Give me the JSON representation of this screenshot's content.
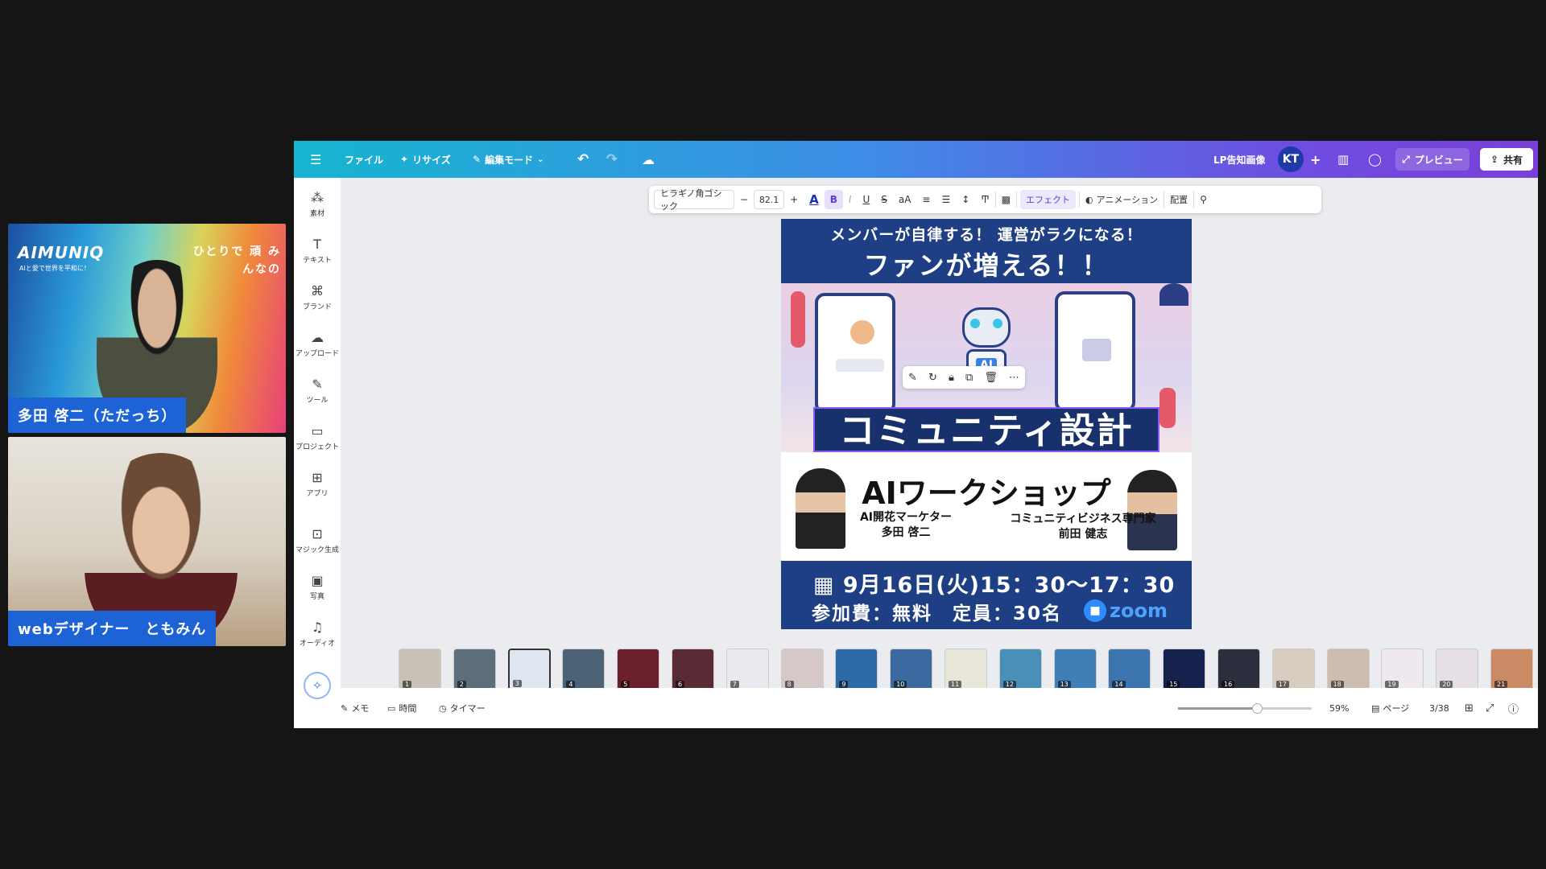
{
  "participants": [
    {
      "name": "多田 啓二（ただっち）",
      "bg_logo": "AIMUNIQ",
      "bg_logo_sub": "AIと愛で世界を平和に！",
      "bg_tagline": "ひとりで 頑 みんなの"
    },
    {
      "name": "webデザイナー　ともみん"
    }
  ],
  "topbar": {
    "menu_icon": "hamburger-icon",
    "file": "ファイル",
    "resize": "リサイズ",
    "edit_mode": "編集モード",
    "project_name": "LP告知画像",
    "avatar": "KT",
    "add": "+",
    "preview": "プレビュー",
    "share": "共有"
  },
  "sidebar": [
    {
      "label": "素材",
      "icon": "elements-icon"
    },
    {
      "label": "テキスト",
      "icon": "text-icon"
    },
    {
      "label": "ブランド",
      "icon": "brand-icon"
    },
    {
      "label": "アップロード",
      "icon": "upload-icon"
    },
    {
      "label": "ツール",
      "icon": "draw-icon"
    },
    {
      "label": "プロジェクト",
      "icon": "folder-icon"
    },
    {
      "label": "アプリ",
      "icon": "apps-icon"
    },
    {
      "label": "マジック生成",
      "icon": "magic-icon"
    },
    {
      "label": "写真",
      "icon": "photo-icon"
    },
    {
      "label": "オーディオ",
      "icon": "audio-icon"
    }
  ],
  "textbar": {
    "font": "ヒラギノ角ゴシック",
    "minus": "−",
    "size": "82.1",
    "plus": "+",
    "color_glyph": "A",
    "bold": "B",
    "italic": "I",
    "underline": "U",
    "strike": "S",
    "case": "aA",
    "effect": "エフェクト",
    "animation": "アニメーション",
    "position": "配置"
  },
  "design": {
    "subtitle": "メンバーが自律する！ 運営がラクになる！",
    "headline": "ファンが増える！！",
    "robot_label": "AI",
    "title": "コミュニティ設計",
    "workshop": "AIワークショップ",
    "speaker1_role": "AI開花マーケター",
    "speaker1_name": "多田 啓二",
    "speaker2_role": "コミュニティビジネス専門家",
    "speaker2_name": "前田 健志",
    "date": "9月16日(火)15：30〜17：30",
    "fee": "参加費：無料　定員：30名",
    "zoom": "zoom"
  },
  "thumbnails": [
    {
      "n": "1",
      "color": "#c7c2b5"
    },
    {
      "n": "2",
      "color": "#5b6e7a"
    },
    {
      "n": "3",
      "color": "#dfe6f2"
    },
    {
      "n": "4",
      "color": "#4c6275"
    },
    {
      "n": "5",
      "color": "#6b1f2a"
    },
    {
      "n": "6",
      "color": "#5a2a35"
    },
    {
      "n": "7",
      "color": "#e9e9ef"
    },
    {
      "n": "8",
      "color": "#d7c8c8"
    },
    {
      "n": "9",
      "color": "#2c6aa8"
    },
    {
      "n": "10",
      "color": "#3a6aa0"
    },
    {
      "n": "11",
      "color": "#e8e6d8"
    },
    {
      "n": "12",
      "color": "#4a8fb7"
    },
    {
      "n": "13",
      "color": "#3f7fb8"
    },
    {
      "n": "14",
      "color": "#3c74b0"
    },
    {
      "n": "15",
      "color": "#15224e"
    },
    {
      "n": "16",
      "color": "#2b2e3d"
    },
    {
      "n": "17",
      "color": "#d8cbc0"
    },
    {
      "n": "18",
      "color": "#cdbcb0"
    },
    {
      "n": "19",
      "color": "#efe8ef"
    },
    {
      "n": "20",
      "color": "#e6dfe6"
    },
    {
      "n": "21",
      "color": "#c98a64"
    },
    {
      "n": "",
      "color": "#e2e2e6"
    }
  ],
  "bottombar": {
    "memo": "メモ",
    "time": "時間",
    "timer": "タイマー",
    "zoom_level": 59,
    "zoom_label": "59%",
    "pages": "ページ",
    "page_count": "3/38"
  }
}
